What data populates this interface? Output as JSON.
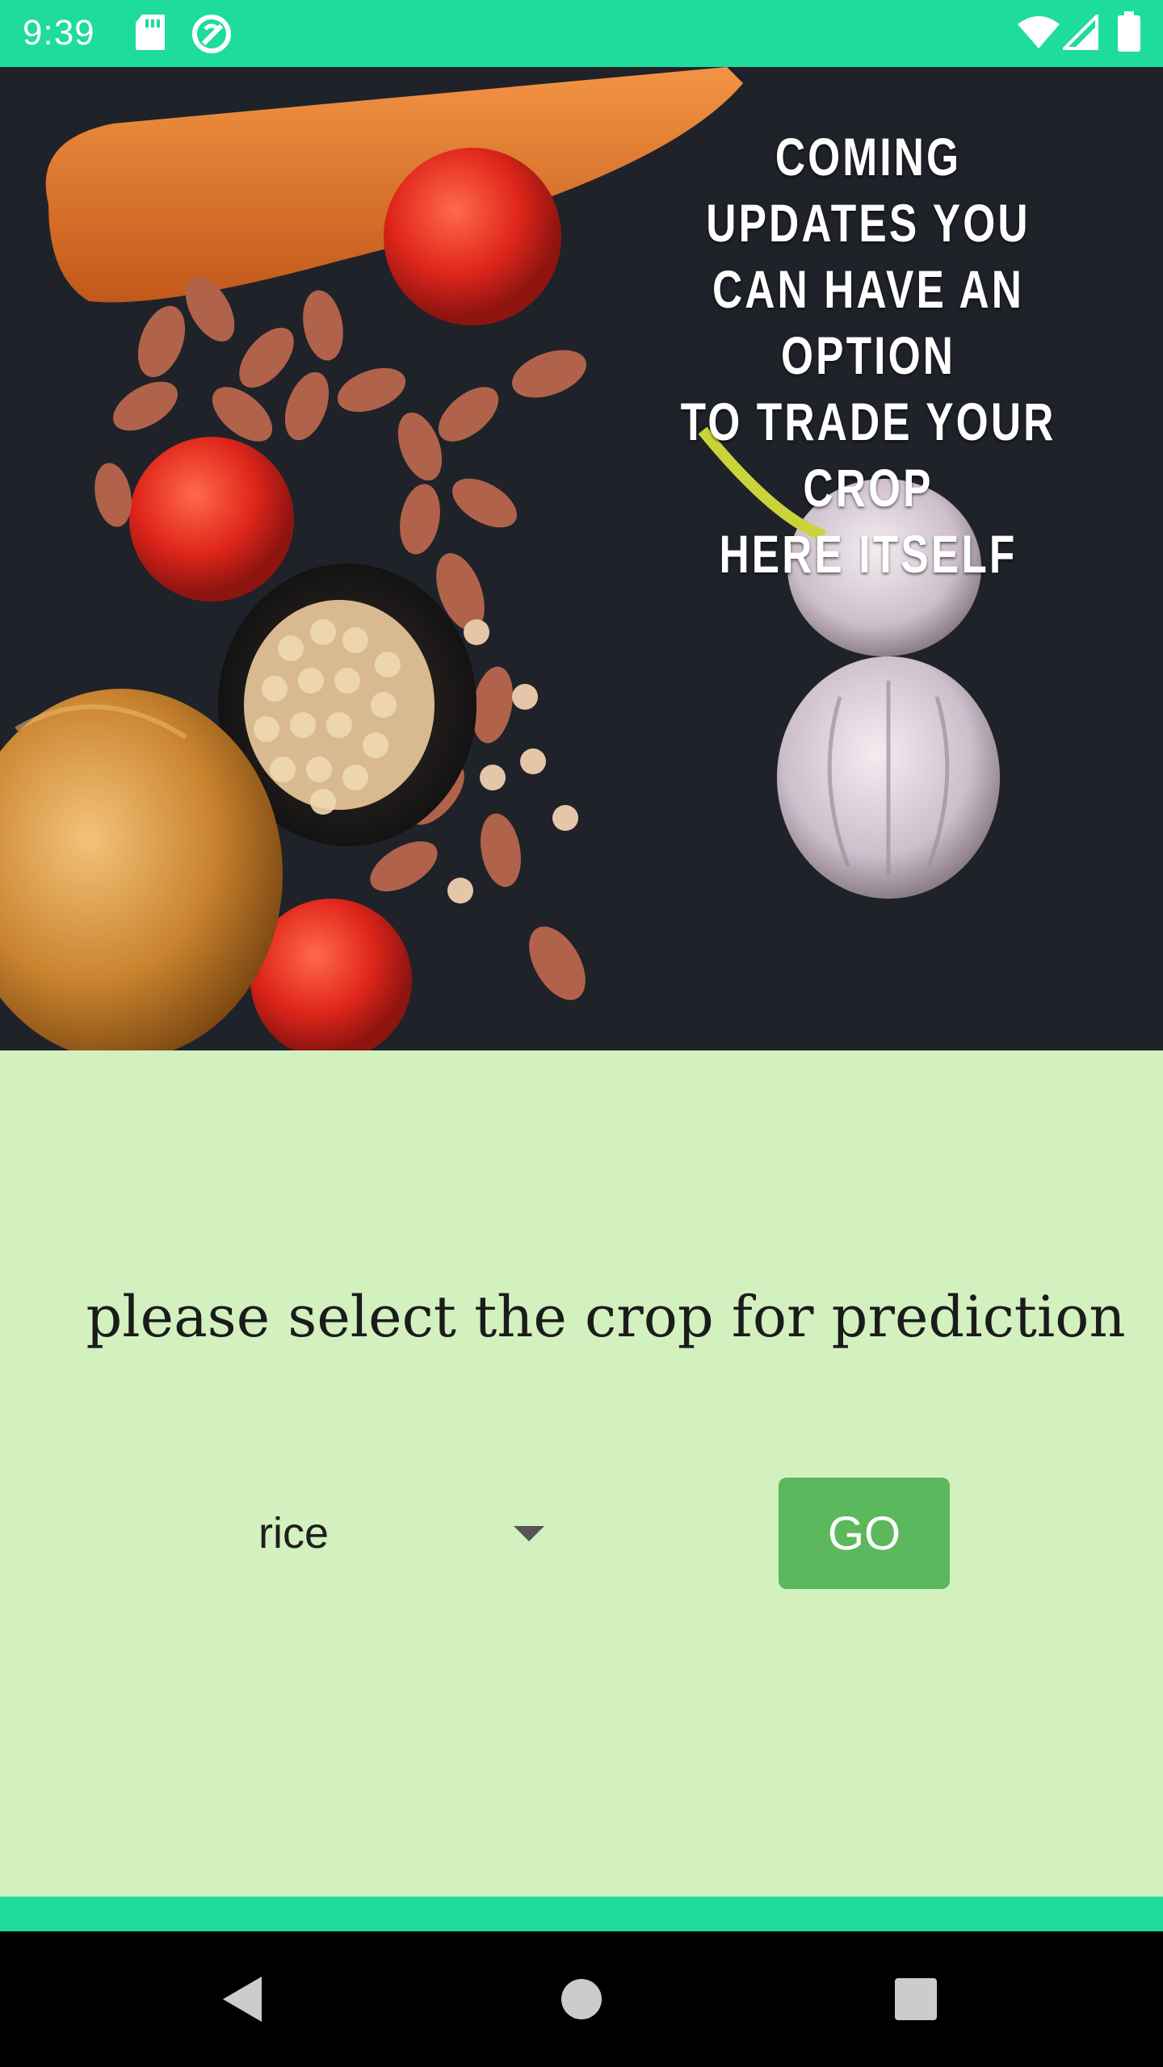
{
  "status_bar": {
    "time": "9:39",
    "background": "#1edc99",
    "icons": [
      "sd-card-icon",
      "sync-icon",
      "wifi-icon",
      "cell-signal-icon",
      "battery-icon"
    ]
  },
  "banner": {
    "lines": [
      "COMING UPDATES YOU",
      "CAN HAVE AN OPTION",
      "TO TRADE YOUR CROP",
      "HERE ITSELF"
    ]
  },
  "main": {
    "prompt": "please select the crop for prediction",
    "crop_select": {
      "selected": "rice"
    },
    "go_label": "GO",
    "background": "#d3f0bf",
    "button_color": "#5cb85c"
  },
  "nav_bar": {
    "icons": [
      "back-icon",
      "home-icon",
      "recents-icon"
    ]
  }
}
